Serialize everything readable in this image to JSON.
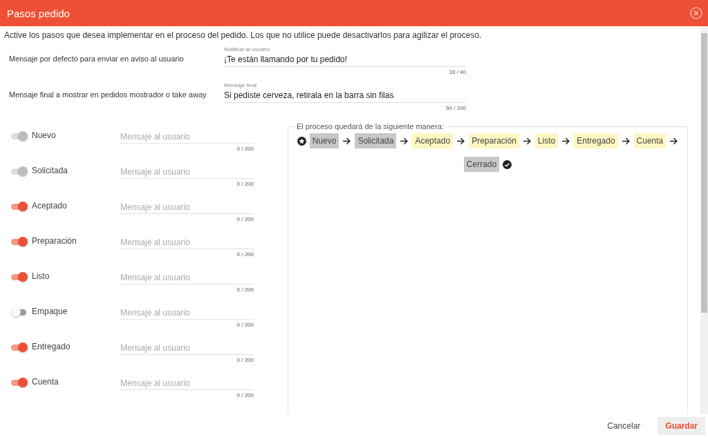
{
  "window": {
    "title": "Pasos pedido"
  },
  "intro": "Active los pasos que desea implementar en el proceso del pedido. Los que no utilice puede desactivarlos para agilizar el proceso.",
  "messages": [
    {
      "label": "Mensaje por defecto para enviar en aviso al usuario",
      "field_label": "Notificar al usuario",
      "value": "¡Te están llamando por tu pedido!",
      "counter": "33 / 40"
    },
    {
      "label": "Mensaje final a mostrar en pedidos mostrador o take away",
      "field_label": "Mensaje final",
      "value": "Si pediste cerveza, retirala en la barra sin filas",
      "counter": "50 / 100"
    }
  ],
  "steps": [
    {
      "label": "Nuevo",
      "on": true,
      "disabled": true,
      "placeholder": "Mensaje al usuario",
      "counter": "0 / 200"
    },
    {
      "label": "Solicitada",
      "on": true,
      "disabled": true,
      "placeholder": "Mensaje al usuario",
      "counter": "0 / 200"
    },
    {
      "label": "Aceptado",
      "on": true,
      "disabled": false,
      "placeholder": "Mensaje al usuario",
      "counter": "0 / 200"
    },
    {
      "label": "Preparación",
      "on": true,
      "disabled": false,
      "placeholder": "Mensaje al usuario",
      "counter": "0 / 200"
    },
    {
      "label": "Listo",
      "on": true,
      "disabled": false,
      "placeholder": "Mensaje al usuario",
      "counter": "0 / 200"
    },
    {
      "label": "Empaque",
      "on": false,
      "disabled": false,
      "placeholder": "Mensaje al usuario",
      "counter": "0 / 200"
    },
    {
      "label": "Entregado",
      "on": true,
      "disabled": false,
      "placeholder": "Mensaje al usuario",
      "counter": "0 / 200"
    },
    {
      "label": "Cuenta",
      "on": true,
      "disabled": false,
      "placeholder": "Mensaje al usuario",
      "counter": "0 / 200"
    }
  ],
  "process": {
    "title": "El proceso quedará de la siguiente manera:",
    "chips": [
      {
        "label": "Nuevo",
        "kind": "fixed"
      },
      {
        "label": "Solicitada",
        "kind": "fixed"
      },
      {
        "label": "Aceptado",
        "kind": "active"
      },
      {
        "label": "Preparación",
        "kind": "active"
      },
      {
        "label": "Listo",
        "kind": "active"
      },
      {
        "label": "Entregado",
        "kind": "active"
      },
      {
        "label": "Cuenta",
        "kind": "active"
      },
      {
        "label": "Cerrado",
        "kind": "fixed"
      }
    ]
  },
  "buttons": [
    {
      "label": "Cancelar",
      "kind": "text"
    },
    {
      "label": "Guardar",
      "kind": "primary"
    }
  ]
}
